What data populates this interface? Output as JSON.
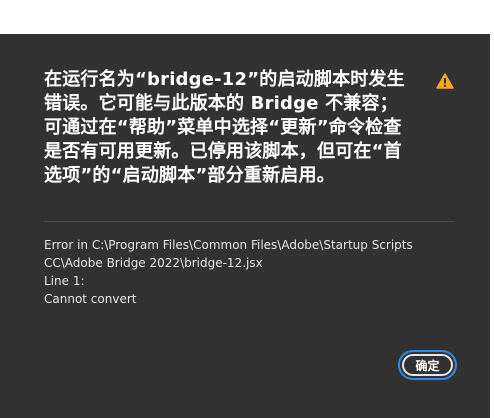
{
  "dialog": {
    "message": "在运行名为“bridge-12”的启动脚本时发生错误。它可能与此版本的 Bridge 不兼容；可通过在“帮助”菜单中选择“更新”命令检查是否有可用更新。已停用该脚本，但可在“首选项”的“启动脚本”部分重新启用。",
    "icon": "warning-icon",
    "details": [
      "Error in C:\\Program Files\\Common Files\\Adobe\\Startup Scripts",
      "CC\\Adobe Bridge 2022\\bridge-12.jsx",
      "Line 1:",
      "Cannot convert"
    ],
    "ok_label": "确定"
  },
  "colors": {
    "background": "#323232",
    "warning": "#f5a623",
    "focus_ring": "#2d8ceb",
    "text": "#ffffff"
  }
}
